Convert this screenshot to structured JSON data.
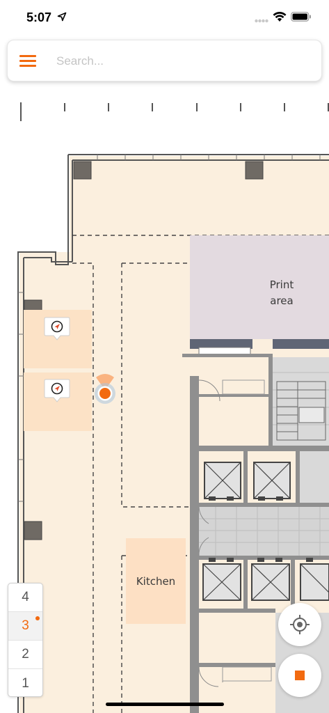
{
  "status_bar": {
    "time": "5:07",
    "icons": [
      "location-arrow-icon",
      "signal-icon",
      "wifi-icon",
      "battery-icon"
    ]
  },
  "search": {
    "placeholder": "Search...",
    "value": "",
    "menu_icon": "hamburger-menu-icon"
  },
  "map": {
    "rooms": [
      {
        "id": "print-area",
        "label_line1": "Print",
        "label_line2": "area"
      },
      {
        "id": "kitchen",
        "label": "Kitchen"
      }
    ],
    "markers": [
      "compass-pin-icon",
      "compass-pin-icon"
    ],
    "user_location": "user-location-dot"
  },
  "floors": {
    "items": [
      "4",
      "3",
      "2",
      "1"
    ],
    "active": "3"
  },
  "controls": {
    "locate_icon": "crosshair-icon",
    "stop_icon": "stop-icon"
  },
  "colors": {
    "accent": "#f26a10",
    "floor_fill": "#fbefde",
    "desk_zone": "#fce2c6",
    "print_area": "#e3dae0",
    "wall": "#8a8a8a",
    "core": "#d6d6d6"
  }
}
